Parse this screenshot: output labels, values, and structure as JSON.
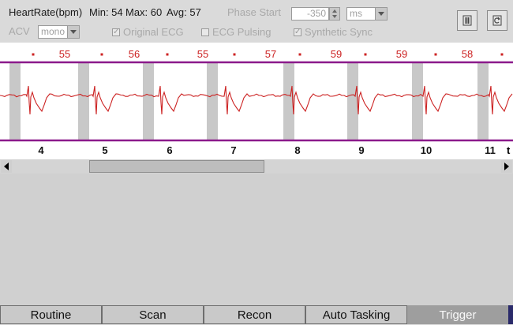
{
  "header": {
    "heart_rate_label": "HeartRate(bpm)",
    "min": "Min: 54",
    "max": "Max: 60",
    "avg": "Avg: 57",
    "phase_start_label": "Phase Start",
    "phase_start_value": "-350",
    "unit_value": "ms",
    "acv_label": "ACV",
    "acv_value": "mono",
    "original_ecg_label": "Original ECG",
    "ecg_pulsing_label": "ECG Pulsing",
    "synthetic_sync_label": "Synthetic Sync",
    "original_ecg_checked": true,
    "ecg_pulsing_checked": false,
    "synthetic_sync_checked": true
  },
  "ecg": {
    "beat_rates": [
      "55",
      "56",
      "55",
      "57",
      "59",
      "59",
      "58"
    ],
    "time_ticks": [
      "4",
      "5",
      "6",
      "7",
      "8",
      "9",
      "10",
      "11"
    ],
    "time_axis_label": "t",
    "colors": {
      "trace": "#cc2222",
      "trigger_band": "#c8c8c8",
      "border_line": "#8b1a8b",
      "rate_text": "#cc2222"
    }
  },
  "icons": {
    "pause": "pause-icon",
    "refresh": "refresh-icon"
  },
  "tabs": [
    {
      "label": "Routine",
      "active": false
    },
    {
      "label": "Scan",
      "active": false
    },
    {
      "label": "Recon",
      "active": false
    },
    {
      "label": "Auto Tasking",
      "active": false
    },
    {
      "label": "Trigger",
      "active": true
    }
  ]
}
